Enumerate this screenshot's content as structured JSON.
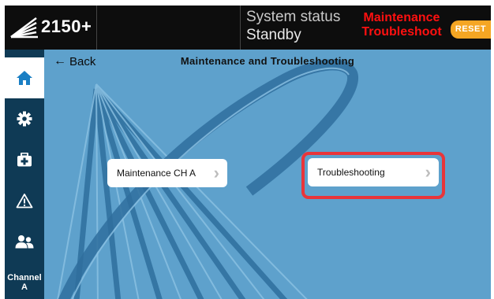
{
  "header": {
    "model": "2150+",
    "status_label": "System status",
    "status_value": "Standby",
    "mode_line1": "Maintenance",
    "mode_line2": "Troubleshoot",
    "reset_label": "RESET",
    "mode_color": "#ff1010",
    "reset_color": "#f5a623"
  },
  "sidebar": {
    "items": [
      {
        "icon": "home-icon",
        "active": true
      },
      {
        "icon": "gear-icon",
        "active": false
      },
      {
        "icon": "first-aid-kit-icon",
        "active": false
      },
      {
        "icon": "warning-icon",
        "active": false
      },
      {
        "icon": "users-icon",
        "active": false
      }
    ],
    "channel_label_1": "Channel",
    "channel_label_2": "A"
  },
  "main": {
    "back_label": "Back",
    "title": "Maintenance and Troubleshooting",
    "buttons": [
      {
        "label": "Maintenance CH A"
      },
      {
        "label": "Troubleshooting",
        "highlighted": true
      }
    ]
  }
}
